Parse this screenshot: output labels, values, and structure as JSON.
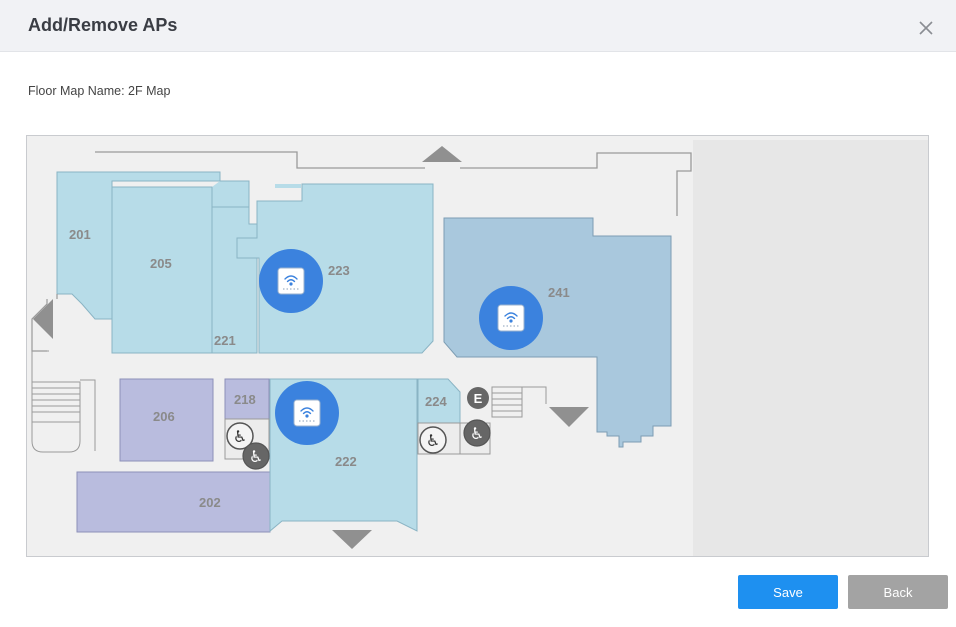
{
  "dialog": {
    "title": "Add/Remove APs",
    "floor_map_label": "Floor Map Name: 2F Map"
  },
  "rooms": [
    "201",
    "205",
    "223",
    "241",
    "221",
    "206",
    "218",
    "224",
    "222",
    "202"
  ],
  "access_points": [
    {
      "room": "223"
    },
    {
      "room": "241"
    },
    {
      "room": "222"
    }
  ],
  "map_markers": {
    "elevator_label": "E"
  },
  "buttons": {
    "save": "Save",
    "back": "Back"
  },
  "colors": {
    "save": "#1e90f0",
    "back": "#a3a3a3",
    "ap_marker": "#3b82de",
    "room_light_blue": "#b7dce8",
    "room_steel_blue": "#a9c8dd",
    "room_lavender": "#b9bcde"
  }
}
